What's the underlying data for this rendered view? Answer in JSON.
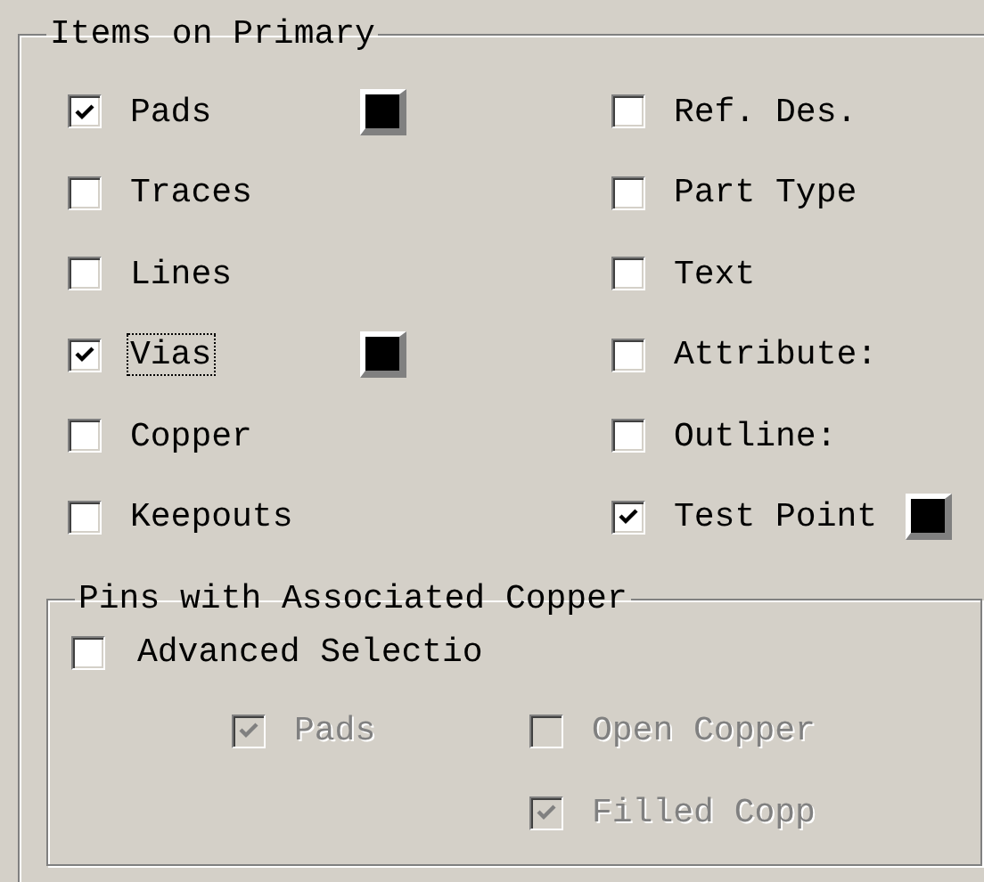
{
  "items_group": {
    "title": "Items on Primary",
    "columns": [
      [
        {
          "label": "Pads",
          "checked": true,
          "focused": false,
          "color": "#000000"
        },
        {
          "label": "Traces",
          "checked": false,
          "focused": false
        },
        {
          "label": "Lines",
          "checked": false,
          "focused": false
        },
        {
          "label": "Vias",
          "checked": true,
          "focused": true,
          "color": "#000000"
        },
        {
          "label": "Copper",
          "checked": false,
          "focused": false
        },
        {
          "label": "Keepouts",
          "checked": false,
          "focused": false
        }
      ],
      [
        {
          "label": "Ref. Des.",
          "checked": false,
          "focused": false
        },
        {
          "label": "Part Type",
          "checked": false,
          "focused": false
        },
        {
          "label": "Text",
          "checked": false,
          "focused": false
        },
        {
          "label": "Attribute:",
          "checked": false,
          "focused": false
        },
        {
          "label": "Outline:",
          "checked": false,
          "focused": false
        },
        {
          "label": "Test Point",
          "checked": true,
          "focused": false,
          "color": "#000000"
        }
      ]
    ],
    "pins_group": {
      "title": "Pins with Associated Copper",
      "advanced": {
        "label": "Advanced Selectio",
        "checked": false,
        "disabled": false
      },
      "columns": [
        [
          {
            "label": "Pads",
            "checked": true,
            "disabled": true
          }
        ],
        [
          {
            "label": "Open Copper",
            "checked": false,
            "disabled": true
          },
          {
            "label": "Filled Copp",
            "checked": true,
            "disabled": true
          }
        ]
      ]
    }
  }
}
